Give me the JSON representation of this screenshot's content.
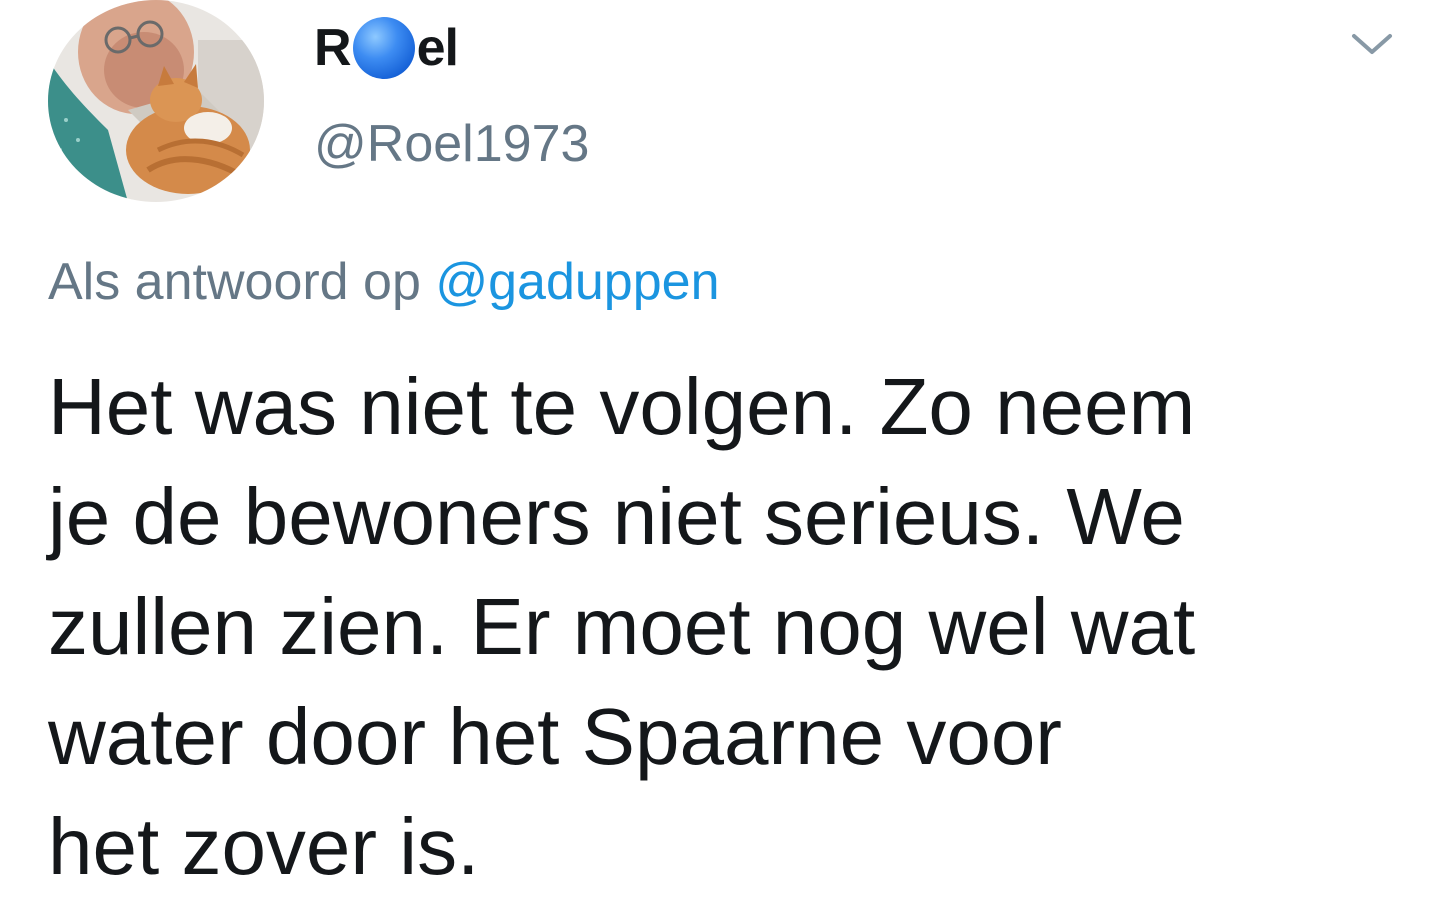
{
  "user": {
    "name_start": "R",
    "name_end": "el",
    "name_emoji": "blue-circle-emoji",
    "handle": "@Roel1973",
    "avatar": "profile-photo-man-with-cat"
  },
  "reply": {
    "prefix": "Als antwoord op ",
    "mention": "@gaduppen"
  },
  "tweet": {
    "text": "Het was niet te volgen. Zo neem\nje de bewoners niet serieus. We\nzullen zien. Er moet nog wel wat\nwater door het Spaarne voor\nhet zover is."
  },
  "menu": {
    "icon": "chevron-down-icon"
  },
  "colors": {
    "text_primary": "#14171a",
    "text_secondary": "#657786",
    "link": "#1b95e0",
    "background": "#ffffff"
  }
}
